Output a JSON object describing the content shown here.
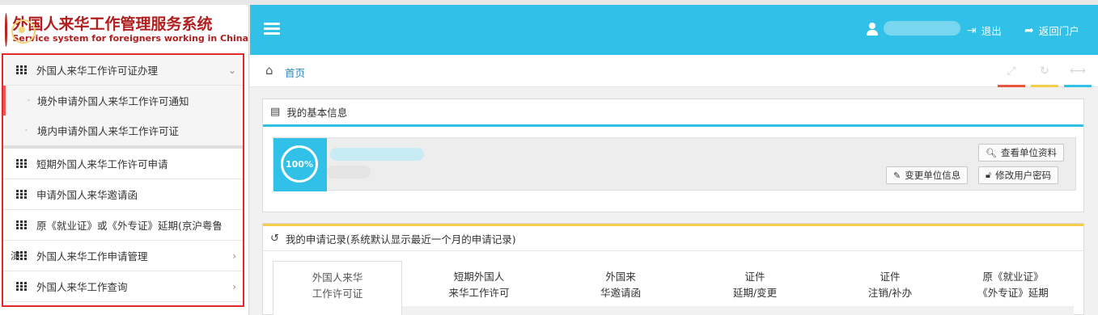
{
  "brand": {
    "title_cn": "外国人来华工作管理服务系统",
    "title_en": "Service system for foreigners working in China"
  },
  "header": {
    "logout_label": "退出",
    "portal_label": "返回门户"
  },
  "sidebar": {
    "collapse_text": "演",
    "items": [
      {
        "label": "外国人来华工作许可证办理",
        "expanded": true
      },
      {
        "label": "短期外国人来华工作许可申请"
      },
      {
        "label": "申请外国人来华邀请函"
      },
      {
        "label": "原《就业证》或《外专证》延期(京沪粤鲁"
      },
      {
        "label": "外国人来华工作申请管理",
        "has_children": true
      },
      {
        "label": "外国人来华工作查询",
        "has_children": true
      }
    ],
    "subitems": [
      {
        "label": "境外申请外国人来华工作许可通知"
      },
      {
        "label": "境内申请外国人来华工作许可证"
      }
    ]
  },
  "breadcrumb": {
    "home": "首页"
  },
  "basic_info": {
    "title": "我的基本信息",
    "completion": "100%",
    "view_button": "查看单位资料",
    "change_button": "变更单位信息",
    "password_button": "修改用户密码"
  },
  "records": {
    "title": "我的申请记录(系统默认显示最近一个月的申请记录)",
    "tabs": [
      {
        "line1": "外国人来华",
        "line2": "工作许可证"
      },
      {
        "line1": "短期外国人",
        "line2": "来华工作许可"
      },
      {
        "line1": "外国来",
        "line2": "华邀请函"
      },
      {
        "line1": "证件",
        "line2": "延期/变更"
      },
      {
        "line1": "证件",
        "line2": "注销/补办"
      },
      {
        "line1": "原《就业证》",
        "line2": "《外专证》延期"
      }
    ]
  },
  "colors": {
    "accent": "#31c0e7",
    "brand_red": "#b01e1e",
    "highlight_border": "#e02a2a",
    "tool_bar_1": "#e8563f",
    "tool_bar_2": "#f4cd4b",
    "tool_bar_3": "#31c0e7"
  }
}
